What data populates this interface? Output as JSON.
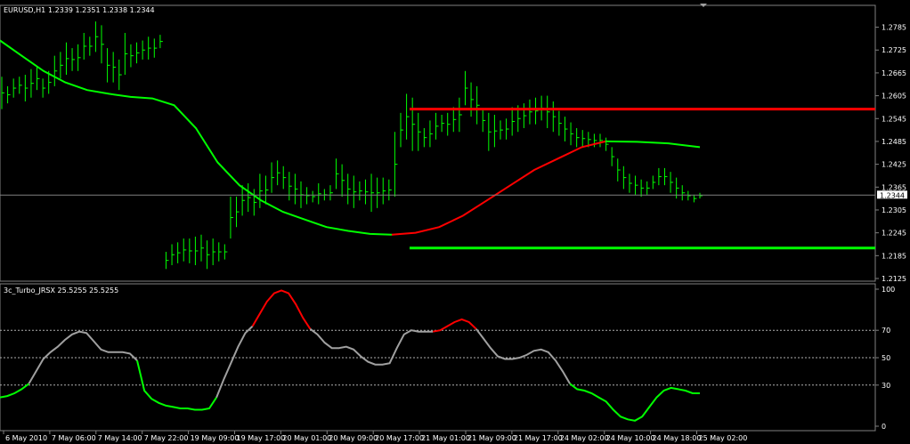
{
  "chart_data": [
    {
      "type": "line",
      "title": "EURUSD,H1",
      "ohlc_label": "1.2339 1.2351 1.2338 1.2344",
      "current_price": 1.2344,
      "current_price_label": "1.2344",
      "ylim": [
        1.2125,
        1.2805
      ],
      "y_ticks": [
        1.2785,
        1.2725,
        1.2665,
        1.2605,
        1.2545,
        1.2485,
        1.2425,
        1.2365,
        1.2305,
        1.2245,
        1.2185,
        1.2125
      ],
      "y_tick_labels": [
        "1.2785",
        "1.2725",
        "1.2665",
        "1.2605",
        "1.2545",
        "1.2485",
        "1.2425",
        "1.2365",
        "1.2305",
        "1.2245",
        "1.2185",
        "1.2125"
      ],
      "x_labels": [
        "6 May 2010",
        "7 May 06:00",
        "7 May 14:00",
        "7 May 22:00",
        "19 May 09:00",
        "19 May 17:00",
        "20 May 01:00",
        "20 May 09:00",
        "20 May 17:00",
        "21 May 01:00",
        "21 May 09:00",
        "21 May 17:00",
        "24 May 02:00",
        "24 May 10:00",
        "24 May 18:00",
        "25 May 02:00"
      ],
      "resistance_level": 1.257,
      "support_level": 1.2205,
      "bars_high": [
        1.2655,
        1.263,
        1.265,
        1.2655,
        1.266,
        1.2675,
        1.268,
        1.265,
        1.267,
        1.271,
        1.272,
        1.2745,
        1.273,
        1.274,
        1.277,
        1.276,
        1.28,
        1.279,
        1.273,
        1.272,
        1.27,
        1.277,
        1.274,
        1.2745,
        1.275,
        1.276,
        1.2755,
        1.2765,
        1.2195,
        1.2215,
        1.222,
        1.223,
        1.223,
        1.2235,
        1.224,
        1.2225,
        1.223,
        1.222,
        1.2215,
        1.234,
        1.234,
        1.237,
        1.2375,
        1.236,
        1.24,
        1.2395,
        1.243,
        1.2435,
        1.242,
        1.2405,
        1.24,
        1.238,
        1.2365,
        1.2355,
        1.2375,
        1.236,
        1.237,
        1.244,
        1.2425,
        1.24,
        1.2395,
        1.238,
        1.2385,
        1.24,
        1.239,
        1.239,
        1.2385,
        1.251,
        1.256,
        1.261,
        1.26,
        1.256,
        1.252,
        1.254,
        1.256,
        1.2555,
        1.256,
        1.2575,
        1.26,
        1.267,
        1.264,
        1.263,
        1.257,
        1.256,
        1.2555,
        1.254,
        1.2545,
        1.2575,
        1.258,
        1.2585,
        1.2595,
        1.26,
        1.2605,
        1.2605,
        1.259,
        1.2565,
        1.255,
        1.2535,
        1.252,
        1.2515,
        1.251,
        1.2505,
        1.2505,
        1.2495,
        1.247,
        1.244,
        1.242,
        1.24,
        1.2395,
        1.2385,
        1.238,
        1.2395,
        1.2415,
        1.2415,
        1.2405,
        1.239,
        1.237,
        1.2355,
        1.2345,
        1.235
      ],
      "bars_low": [
        1.257,
        1.2585,
        1.26,
        1.261,
        1.259,
        1.26,
        1.262,
        1.26,
        1.261,
        1.263,
        1.265,
        1.266,
        1.267,
        1.267,
        1.27,
        1.271,
        1.272,
        1.269,
        1.264,
        1.264,
        1.262,
        1.266,
        1.268,
        1.269,
        1.27,
        1.27,
        1.2705,
        1.273,
        1.215,
        1.216,
        1.2165,
        1.217,
        1.2165,
        1.216,
        1.217,
        1.215,
        1.216,
        1.217,
        1.2175,
        1.223,
        1.226,
        1.229,
        1.23,
        1.229,
        1.231,
        1.232,
        1.235,
        1.237,
        1.236,
        1.233,
        1.232,
        1.231,
        1.232,
        1.2325,
        1.232,
        1.233,
        1.233,
        1.236,
        1.234,
        1.232,
        1.231,
        1.233,
        1.232,
        1.23,
        1.231,
        1.232,
        1.233,
        1.234,
        1.247,
        1.249,
        1.246,
        1.246,
        1.247,
        1.247,
        1.249,
        1.251,
        1.25,
        1.251,
        1.251,
        1.258,
        1.255,
        1.253,
        1.251,
        1.246,
        1.247,
        1.249,
        1.249,
        1.25,
        1.251,
        1.252,
        1.253,
        1.253,
        1.254,
        1.252,
        1.251,
        1.25,
        1.2485,
        1.2475,
        1.247,
        1.247,
        1.247,
        1.247,
        1.247,
        1.246,
        1.242,
        1.238,
        1.236,
        1.235,
        1.2345,
        1.234,
        1.2345,
        1.236,
        1.237,
        1.237,
        1.235,
        1.2335,
        1.233,
        1.233,
        1.2325,
        1.2335
      ],
      "ma_segments": [
        {
          "color": "#00ff00",
          "values": [
            1.275,
            1.271,
            1.267,
            1.264,
            1.262,
            1.261,
            1.2602,
            1.2598,
            1.258,
            1.252,
            1.243,
            1.237,
            1.233,
            1.23,
            1.228,
            1.226,
            1.225,
            1.2242,
            1.224
          ]
        },
        {
          "color": "#ff0000",
          "values": [
            1.224,
            1.2245,
            1.226,
            1.229,
            1.233,
            1.237,
            1.241,
            1.244,
            1.247,
            1.2485
          ]
        },
        {
          "color": "#00ff00",
          "values": [
            1.2485,
            1.2484,
            1.248,
            1.247
          ]
        }
      ]
    },
    {
      "type": "line",
      "title": "3c_Turbo_JRSX 25.5255 25.5255",
      "ylim": [
        0,
        100
      ],
      "y_ticks": [
        100,
        70,
        50,
        30,
        0
      ],
      "y_tick_labels": [
        "100",
        "70",
        "50",
        "30",
        "0"
      ],
      "levels": [
        70,
        50,
        30
      ],
      "values": [
        21,
        22,
        24,
        27,
        31,
        40,
        49,
        54,
        58,
        63,
        67,
        69,
        68,
        62,
        56,
        54,
        54,
        54,
        53,
        48,
        26,
        20,
        17,
        15,
        14,
        13,
        13,
        12,
        12,
        13,
        21,
        34,
        46,
        58,
        68,
        73,
        82,
        91,
        97,
        99,
        97,
        89,
        79,
        71,
        67,
        61,
        57,
        57,
        58,
        56,
        51,
        47,
        45,
        45,
        46,
        57,
        67,
        70,
        69,
        69,
        69,
        70,
        73,
        76,
        78,
        76,
        71,
        64,
        57,
        51,
        49,
        49,
        50,
        52,
        55,
        56,
        54,
        48,
        40,
        31,
        27,
        26,
        24,
        21,
        18,
        12,
        7,
        5,
        4,
        7,
        14,
        21,
        26,
        28,
        27,
        26,
        24,
        24
      ],
      "color_segments": [
        {
          "from": 0,
          "to": 4,
          "color": "#00ff00"
        },
        {
          "from": 4,
          "to": 19,
          "color": "#a0a0a0"
        },
        {
          "from": 19,
          "to": 30,
          "color": "#00ff00"
        },
        {
          "from": 30,
          "to": 35,
          "color": "#a0a0a0"
        },
        {
          "from": 35,
          "to": 43,
          "color": "#ff0000"
        },
        {
          "from": 43,
          "to": 60,
          "color": "#a0a0a0"
        },
        {
          "from": 60,
          "to": 66,
          "color": "#ff0000"
        },
        {
          "from": 66,
          "to": 79,
          "color": "#a0a0a0"
        },
        {
          "from": 79,
          "to": 97,
          "color": "#00ff00"
        }
      ]
    }
  ]
}
